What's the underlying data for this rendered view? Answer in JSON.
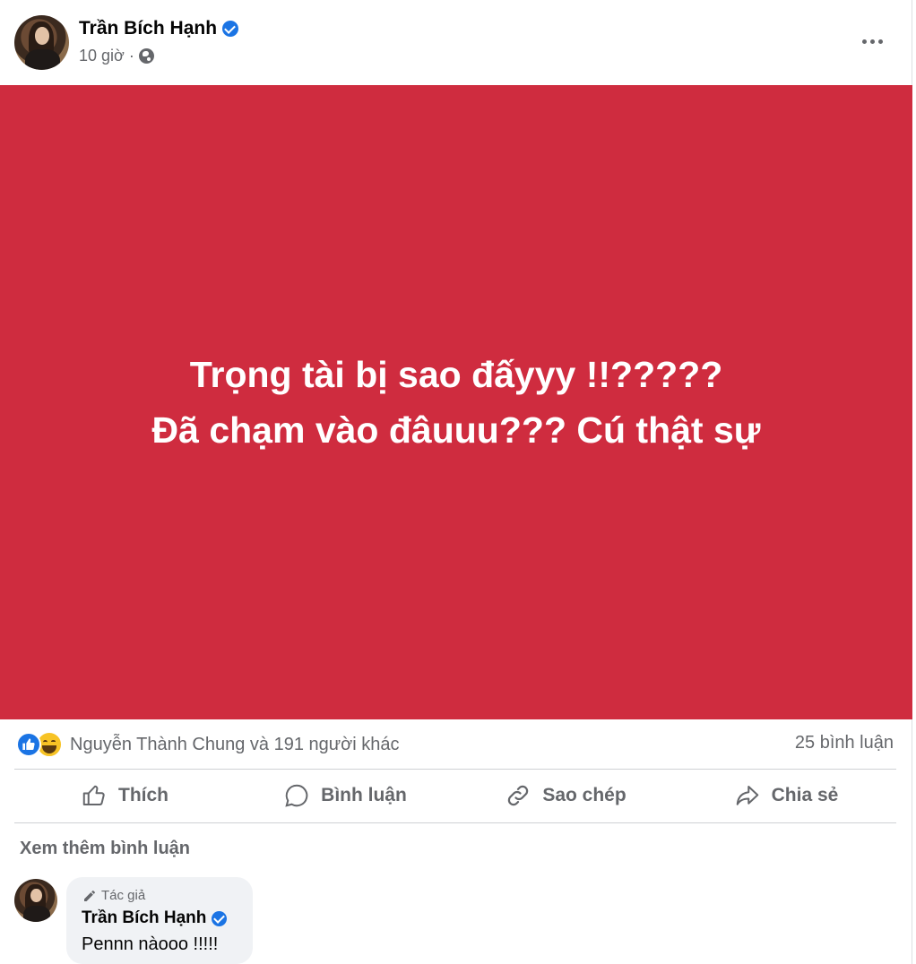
{
  "header": {
    "author": "Trần Bích Hạnh",
    "time": "10 giờ",
    "separator": "·",
    "privacy_icon": "globe-icon",
    "more_icon": "more-horizontal-icon"
  },
  "post": {
    "line1": "Trọng tài bị sao đấyyy !!?????",
    "line2": "Đã chạm vào đâuuu??? Cú thật sự",
    "background_color": "#cf2c3f"
  },
  "stats": {
    "reaction_icons": [
      "like-reaction-icon",
      "haha-reaction-icon"
    ],
    "reactions_text": "Nguyễn Thành Chung và 191 người khác",
    "comments_text": "25 bình luận"
  },
  "actions": {
    "like": "Thích",
    "comment": "Bình luận",
    "copy": "Sao chép",
    "share": "Chia sẻ"
  },
  "comments": {
    "view_more": "Xem thêm bình luận",
    "items": [
      {
        "badge": "Tác giả",
        "author": "Trần Bích Hạnh",
        "text": "Pennn nàooo !!!!!"
      }
    ]
  },
  "colors": {
    "accent": "#1b74e4",
    "secondary_text": "#65676b"
  }
}
